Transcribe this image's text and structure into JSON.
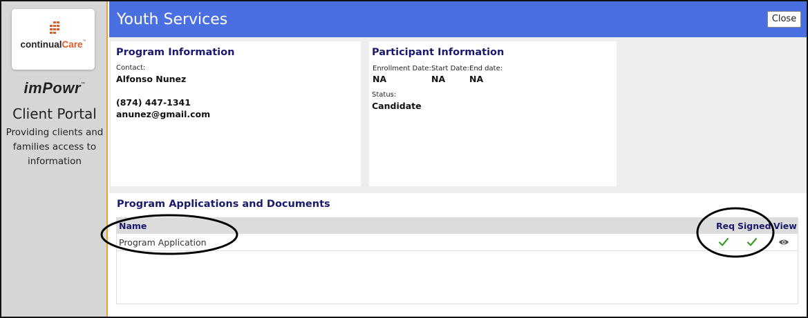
{
  "sidebar": {
    "logo_text_main": "continual",
    "logo_text_accent": "Care",
    "logo_tm": "™",
    "brand": "imPowr",
    "brand_tm": "™",
    "portal_title": "Client Portal",
    "portal_subtitle": "Providing clients and families access to information",
    "accent_color": "#e05a28"
  },
  "header": {
    "title": "Youth Services",
    "close_label": "Close",
    "background": "#4a6fe0"
  },
  "program_info": {
    "title": "Program Information",
    "contact_label": "Contact:",
    "contact_name": "Alfonso Nunez",
    "phone": "(874) 447-1341",
    "email": "anunez@gmail.com"
  },
  "participant_info": {
    "title": "Participant Information",
    "enrollment_label": "Enrollment Date:",
    "enrollment_value": "NA",
    "start_label": "Start Date:",
    "start_value": "NA",
    "end_label": "End date:",
    "end_value": "NA",
    "status_label": "Status:",
    "status_value": "Candidate"
  },
  "documents": {
    "title": "Program Applications and Documents",
    "columns": {
      "name": "Name",
      "req": "Req",
      "signed": "Signed",
      "view": "View"
    },
    "rows": [
      {
        "name": "Program Application",
        "req": true,
        "signed": true,
        "view_icon": "eye-icon"
      }
    ]
  }
}
